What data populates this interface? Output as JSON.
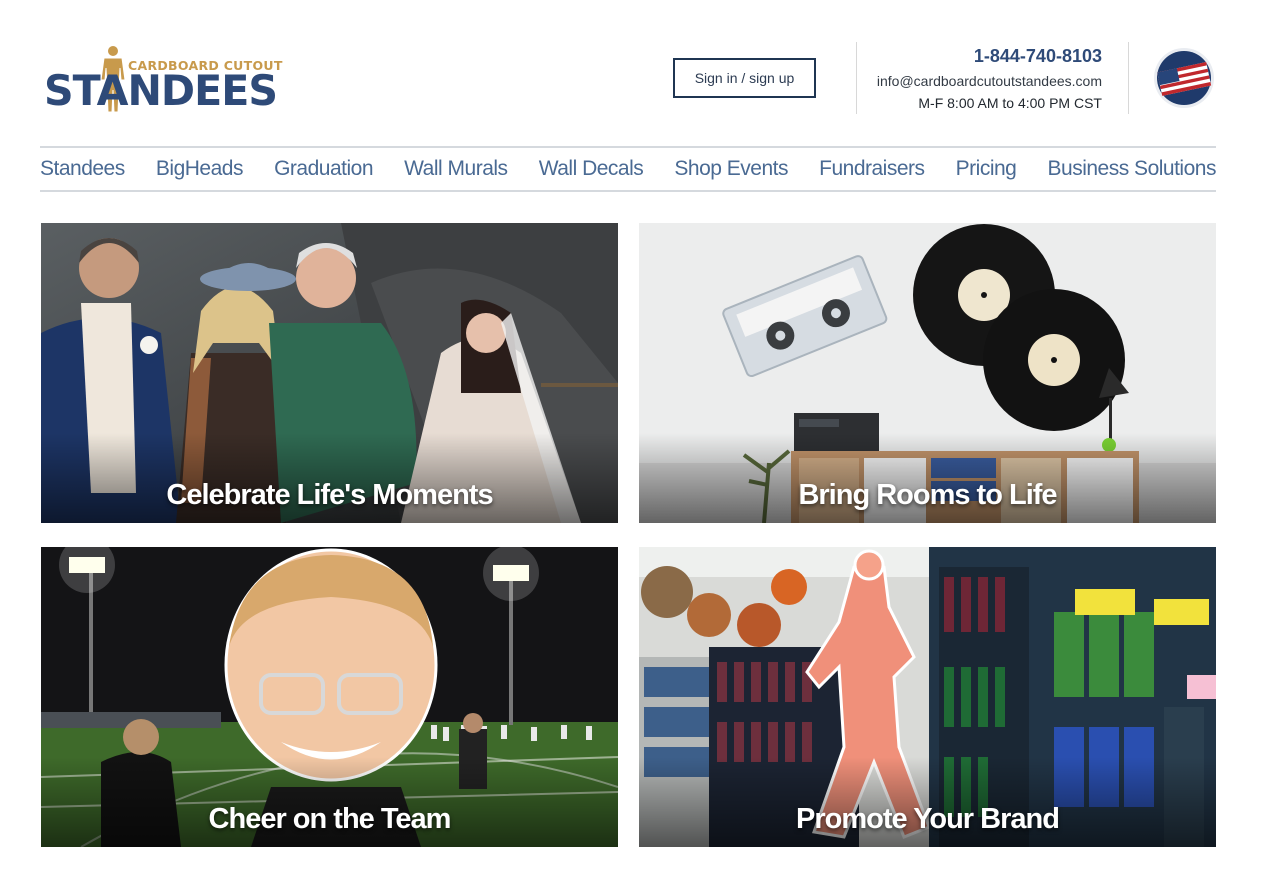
{
  "logo": {
    "top_text": "CARDBOARD CUTOUT",
    "main_text": "STANDEES",
    "badge_text": "MADE IN THE U.S.A."
  },
  "header": {
    "signin_label": "Sign in / sign up",
    "phone": "1-844-740-8103",
    "email": "info@cardboardcutoutstandees.com",
    "hours": "M-F 8:00 AM to 4:00 PM CST"
  },
  "nav": {
    "items": [
      {
        "label": "Standees"
      },
      {
        "label": "BigHeads"
      },
      {
        "label": "Graduation"
      },
      {
        "label": "Wall Murals"
      },
      {
        "label": "Wall Decals"
      },
      {
        "label": "Shop Events"
      },
      {
        "label": "Fundraisers"
      },
      {
        "label": "Pricing"
      },
      {
        "label": "Business Solutions"
      }
    ]
  },
  "tiles": [
    {
      "caption": "Celebrate Life's Moments"
    },
    {
      "caption": "Bring Rooms to Life"
    },
    {
      "caption": "Cheer on the Team"
    },
    {
      "caption": "Promote Your Brand"
    }
  ],
  "colors": {
    "brand_blue": "#2e4a78",
    "brand_gold": "#c89a4c",
    "nav_text": "#4a6a93",
    "divider": "#d5d9de"
  }
}
